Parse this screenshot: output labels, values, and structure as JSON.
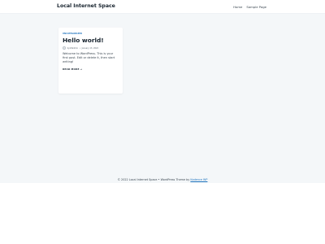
{
  "header": {
    "site_title": "Local Internet Space",
    "nav": [
      "Home",
      "Sample Page"
    ]
  },
  "post": {
    "category": "UNCATEGORIZED",
    "title": "Hello world!",
    "author": "by1ifadmin",
    "date": "January 13, 2022",
    "excerpt": "Welcome to WordPress. This is your first post. Edit or delete it, then start writing!",
    "read_more": "READ MORE →"
  },
  "footer": {
    "text": "© 2022 Local Internet Space • WordPress Theme by ",
    "link": "Kadence WP"
  },
  "colors": {
    "background": "#f4f7f9",
    "accent": "#1e73be",
    "heading": "#16222d"
  }
}
